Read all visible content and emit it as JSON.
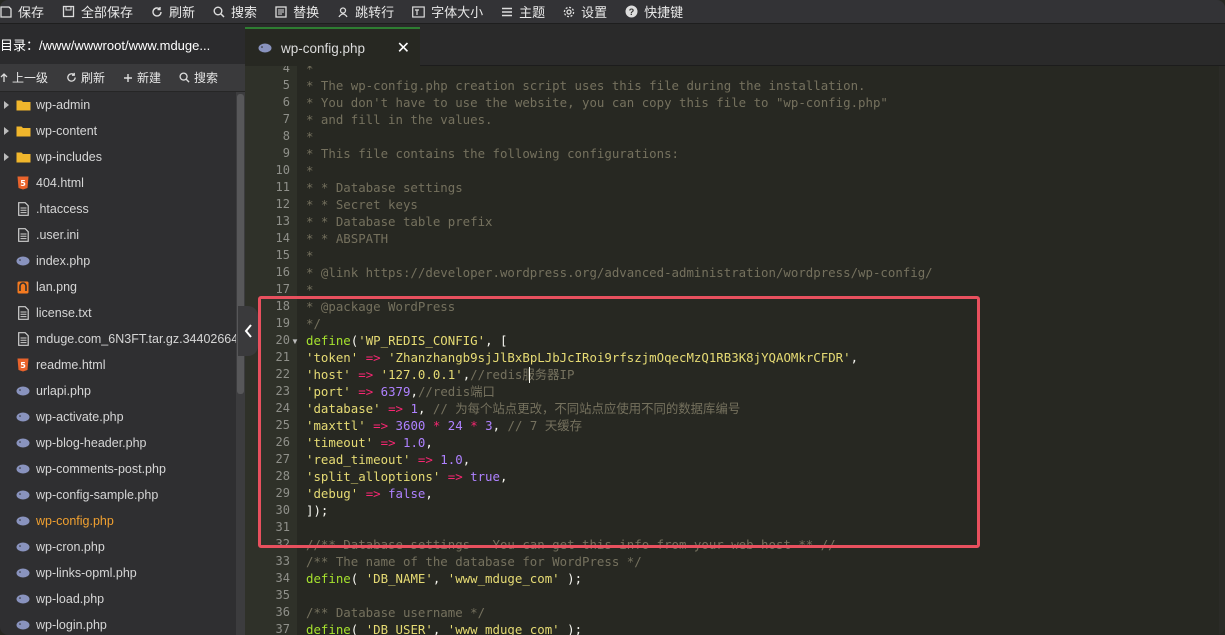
{
  "toolbar": {
    "save": "保存",
    "save_all": "全部保存",
    "refresh": "刷新",
    "search": "搜索",
    "replace": "替换",
    "goto_line": "跳转行",
    "font_size": "字体大小",
    "theme": "主题",
    "settings": "设置",
    "shortcuts": "快捷键"
  },
  "sidebar": {
    "dir_label": "目录：/www/wwwroot/www.mduge...",
    "actions": {
      "up": "上一级",
      "refresh": "刷新",
      "new": "新建",
      "search": "搜索"
    },
    "files": [
      {
        "name": "wp-admin",
        "type": "folder"
      },
      {
        "name": "wp-content",
        "type": "folder"
      },
      {
        "name": "wp-includes",
        "type": "folder"
      },
      {
        "name": "404.html",
        "type": "html"
      },
      {
        "name": ".htaccess",
        "type": "text"
      },
      {
        "name": ".user.ini",
        "type": "text"
      },
      {
        "name": "index.php",
        "type": "php"
      },
      {
        "name": "lan.png",
        "type": "image"
      },
      {
        "name": "license.txt",
        "type": "text"
      },
      {
        "name": "mduge.com_6N3FT.tar.gz.34402664",
        "type": "text"
      },
      {
        "name": "readme.html",
        "type": "html"
      },
      {
        "name": "urlapi.php",
        "type": "php"
      },
      {
        "name": "wp-activate.php",
        "type": "php"
      },
      {
        "name": "wp-blog-header.php",
        "type": "php"
      },
      {
        "name": "wp-comments-post.php",
        "type": "php"
      },
      {
        "name": "wp-config-sample.php",
        "type": "php"
      },
      {
        "name": "wp-config.php",
        "type": "php",
        "active": true
      },
      {
        "name": "wp-cron.php",
        "type": "php"
      },
      {
        "name": "wp-links-opml.php",
        "type": "php"
      },
      {
        "name": "wp-load.php",
        "type": "php"
      },
      {
        "name": "wp-login.php",
        "type": "php"
      }
    ]
  },
  "tab": {
    "label": "wp-config.php",
    "close": "✕"
  },
  "editor": {
    "lines": [
      {
        "n": "4",
        "t": "*"
      },
      {
        "n": "5",
        "t": "* The wp-config.php creation script uses this file during the installation."
      },
      {
        "n": "6",
        "t": "* You don't have to use the website, you can copy this file to \"wp-config.php\""
      },
      {
        "n": "7",
        "t": "* and fill in the values."
      },
      {
        "n": "8",
        "t": "*"
      },
      {
        "n": "9",
        "t": "* This file contains the following configurations:"
      },
      {
        "n": "10",
        "t": "*"
      },
      {
        "n": "11",
        "t": "* * Database settings"
      },
      {
        "n": "12",
        "t": "* * Secret keys"
      },
      {
        "n": "13",
        "t": "* * Database table prefix"
      },
      {
        "n": "14",
        "t": "* * ABSPATH"
      },
      {
        "n": "15",
        "t": "*"
      },
      {
        "n": "16",
        "t": "* @link https://developer.wordpress.org/advanced-administration/wordpress/wp-config/"
      },
      {
        "n": "17",
        "t": "*"
      },
      {
        "n": "18",
        "t": "* @package WordPress"
      },
      {
        "n": "19",
        "t": "*/"
      },
      {
        "n": "20",
        "t": "define('WP_REDIS_CONFIG', ["
      },
      {
        "n": "21",
        "t": "'token' => 'Zhanzhangb9sjJlBxBpLJbJcIRoi9rfszjmOqecMzQ1RB3K8jYQAOMkrCFDR',"
      },
      {
        "n": "22",
        "t": "'host' => '127.0.0.1',//redis服务器IP"
      },
      {
        "n": "23",
        "t": "'port' => 6379,//redis端口"
      },
      {
        "n": "24",
        "t": "'database' => 1, // 为每个站点更改，不同站点应使用不同的数据库编号"
      },
      {
        "n": "25",
        "t": "'maxttl' => 3600 * 24 * 3, // 7 天缓存"
      },
      {
        "n": "26",
        "t": "'timeout' => 1.0,"
      },
      {
        "n": "27",
        "t": "'read_timeout' => 1.0,"
      },
      {
        "n": "28",
        "t": "'split_alloptions' => true,"
      },
      {
        "n": "29",
        "t": "'debug' => false,"
      },
      {
        "n": "30",
        "t": "]);"
      },
      {
        "n": "31",
        "t": ""
      },
      {
        "n": "32",
        "t": "//** Database settings - You can get this info from your web host ** //"
      },
      {
        "n": "33",
        "t": "/** The name of the database for WordPress */"
      },
      {
        "n": "34",
        "t": "define( 'DB_NAME', 'www_mduge_com' );"
      },
      {
        "n": "35",
        "t": ""
      },
      {
        "n": "36",
        "t": "/** Database username */"
      },
      {
        "n": "37",
        "t": "define( 'DB_USER', 'www_mduge_com' );"
      }
    ]
  },
  "colors": {
    "highlight_box": "#e8505e",
    "active_file": "#f0a030",
    "tab_accent": "#2e7d32"
  }
}
